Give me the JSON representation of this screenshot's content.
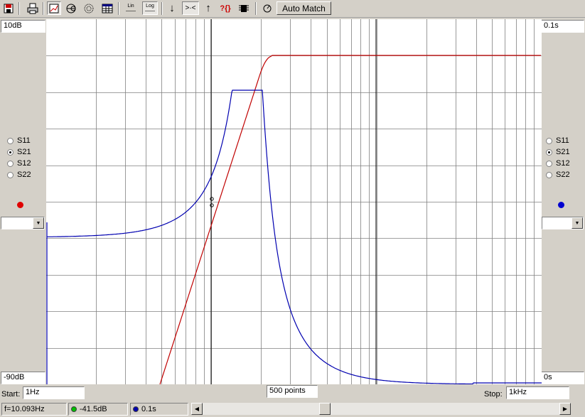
{
  "toolbar": {
    "lin_label": "Lin",
    "log_label": "Log",
    "auto_match_label": "Auto Match",
    "arrow_down": "↓",
    "arrow_in": ">·<",
    "arrow_up": "↑",
    "help": "?{}"
  },
  "left_panel": {
    "top_value": "10dB",
    "bottom_value": "-90dB",
    "params": [
      "S11",
      "S21",
      "S12",
      "S22"
    ],
    "selected": "S21",
    "marker_color": "#e00000"
  },
  "right_panel": {
    "top_value": "0.1s",
    "bottom_value": "0s",
    "params": [
      "S11",
      "S21",
      "S12",
      "S22"
    ],
    "selected": "S21",
    "marker_color": "#0000d0"
  },
  "sweep": {
    "start_label": "Start:",
    "start_value": "1Hz",
    "points_value": "500 points",
    "stop_label": "Stop:",
    "stop_value": "1kHz"
  },
  "status": {
    "frequency": "f=10.093Hz",
    "magnitude": "-41.5dB",
    "magnitude_color": "#00c000",
    "delay": "0.1s",
    "delay_color": "#0000b0"
  },
  "colors": {
    "magnitude_trace": "#c00000",
    "delay_trace": "#0000b0",
    "grid": "#808080"
  }
}
